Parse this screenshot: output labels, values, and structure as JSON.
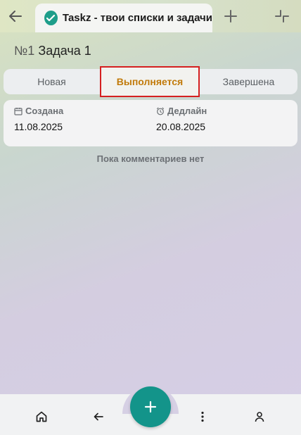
{
  "tab": {
    "title": "Taskz - твои списки и задачи",
    "logo_text": "taskz"
  },
  "task": {
    "number": "№1",
    "name": "Задача 1"
  },
  "status": {
    "options": [
      "Новая",
      "Выполняется",
      "Завершена"
    ],
    "selected": "Выполняется"
  },
  "dates": {
    "created_label": "Создана",
    "created_value": "11.08.2025",
    "deadline_label": "Дедлайн",
    "deadline_value": "20.08.2025"
  },
  "comments": {
    "empty_text": "Пока комментариев нет"
  },
  "colors": {
    "accent": "#13948a",
    "active_status_text": "#c17a0a",
    "highlight_border": "#d52020"
  },
  "bottom_nav": {
    "icons": [
      "home-icon",
      "arrow-left-icon",
      "plus-icon",
      "more-vertical-icon",
      "user-icon"
    ]
  }
}
